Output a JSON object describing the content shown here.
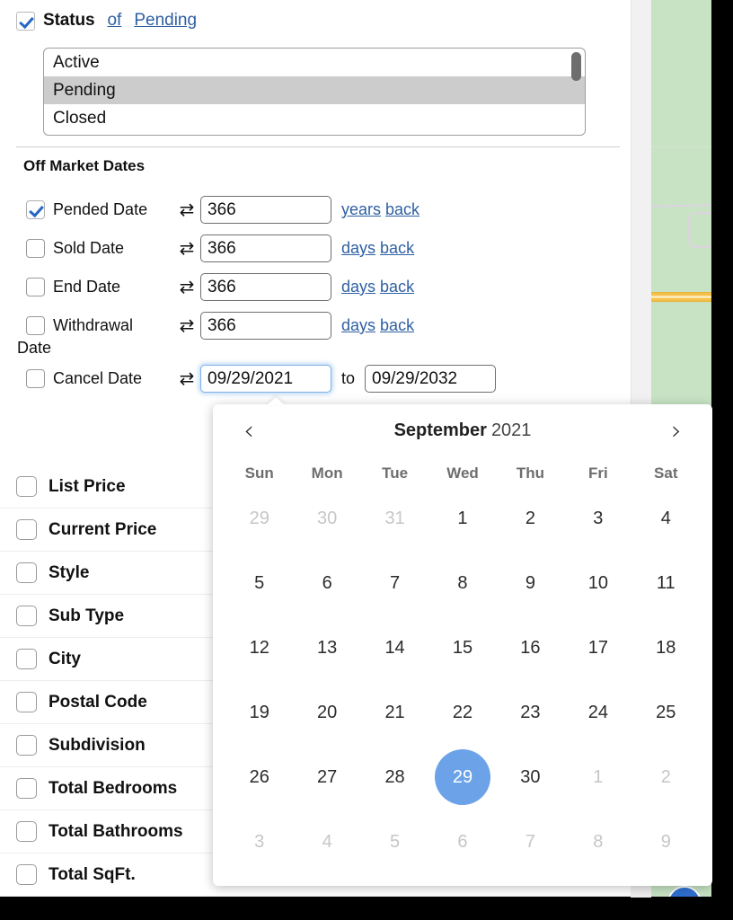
{
  "status": {
    "checked": true,
    "label": "Status",
    "of_link": "of",
    "value_link": "Pending",
    "options": [
      {
        "label": "Active",
        "selected": false
      },
      {
        "label": "Pending",
        "selected": true
      },
      {
        "label": "Closed",
        "selected": false
      }
    ]
  },
  "off_market": {
    "title": "Off Market Dates",
    "swap_icon": "⇄",
    "rows": [
      {
        "label": "Pended Date",
        "checked": true,
        "value": "366",
        "unit": "years",
        "direction": "back"
      },
      {
        "label": "Sold Date",
        "checked": false,
        "value": "366",
        "unit": "days",
        "direction": "back"
      },
      {
        "label": "End Date",
        "checked": false,
        "value": "366",
        "unit": "days",
        "direction": "back"
      },
      {
        "label": "Withdrawal",
        "checked": false,
        "value": "366",
        "unit": "days",
        "direction": "back"
      }
    ],
    "wrap_word": "Date",
    "cancel_row": {
      "label": "Cancel Date",
      "checked": false,
      "from_value": "09/29/2021",
      "to_label": "to",
      "to_value": "09/29/2032"
    }
  },
  "calendar": {
    "prev_icon": "‹",
    "next_icon": "›",
    "month": "September",
    "year": "2021",
    "dow": [
      "Sun",
      "Mon",
      "Tue",
      "Wed",
      "Thu",
      "Fri",
      "Sat"
    ],
    "selected_day": "29",
    "accent": "#6ba2e8",
    "weeks": [
      [
        {
          "d": "29",
          "muted": true
        },
        {
          "d": "30",
          "muted": true
        },
        {
          "d": "31",
          "muted": true
        },
        {
          "d": "1",
          "muted": false
        },
        {
          "d": "2",
          "muted": false
        },
        {
          "d": "3",
          "muted": false
        },
        {
          "d": "4",
          "muted": false
        }
      ],
      [
        {
          "d": "5",
          "muted": false
        },
        {
          "d": "6",
          "muted": false
        },
        {
          "d": "7",
          "muted": false
        },
        {
          "d": "8",
          "muted": false
        },
        {
          "d": "9",
          "muted": false
        },
        {
          "d": "10",
          "muted": false
        },
        {
          "d": "11",
          "muted": false
        }
      ],
      [
        {
          "d": "12",
          "muted": false
        },
        {
          "d": "13",
          "muted": false
        },
        {
          "d": "14",
          "muted": false
        },
        {
          "d": "15",
          "muted": false
        },
        {
          "d": "16",
          "muted": false
        },
        {
          "d": "17",
          "muted": false
        },
        {
          "d": "18",
          "muted": false
        }
      ],
      [
        {
          "d": "19",
          "muted": false
        },
        {
          "d": "20",
          "muted": false
        },
        {
          "d": "21",
          "muted": false
        },
        {
          "d": "22",
          "muted": false
        },
        {
          "d": "23",
          "muted": false
        },
        {
          "d": "24",
          "muted": false
        },
        {
          "d": "25",
          "muted": false
        }
      ],
      [
        {
          "d": "26",
          "muted": false
        },
        {
          "d": "27",
          "muted": false
        },
        {
          "d": "28",
          "muted": false
        },
        {
          "d": "29",
          "muted": false,
          "selected": true
        },
        {
          "d": "30",
          "muted": false
        },
        {
          "d": "1",
          "muted": true
        },
        {
          "d": "2",
          "muted": true
        }
      ],
      [
        {
          "d": "3",
          "muted": true
        },
        {
          "d": "4",
          "muted": true
        },
        {
          "d": "5",
          "muted": true
        },
        {
          "d": "6",
          "muted": true
        },
        {
          "d": "7",
          "muted": true
        },
        {
          "d": "8",
          "muted": true
        },
        {
          "d": "9",
          "muted": true
        }
      ]
    ]
  },
  "fields": [
    {
      "label": "List Price",
      "checked": false
    },
    {
      "label": "Current Price",
      "checked": false
    },
    {
      "label": "Style",
      "checked": false
    },
    {
      "label": "Sub Type",
      "checked": false
    },
    {
      "label": "City",
      "checked": false
    },
    {
      "label": "Postal Code",
      "checked": false
    },
    {
      "label": "Subdivision",
      "checked": false
    },
    {
      "label": "Total Bedrooms",
      "checked": false
    },
    {
      "label": "Total Bathrooms",
      "checked": false
    },
    {
      "label": "Total SqFt.",
      "checked": false
    }
  ],
  "map": {
    "land_color": "#c7e3c4",
    "road_color": "#f5c04a",
    "marker_color": "#2f6fd0"
  }
}
